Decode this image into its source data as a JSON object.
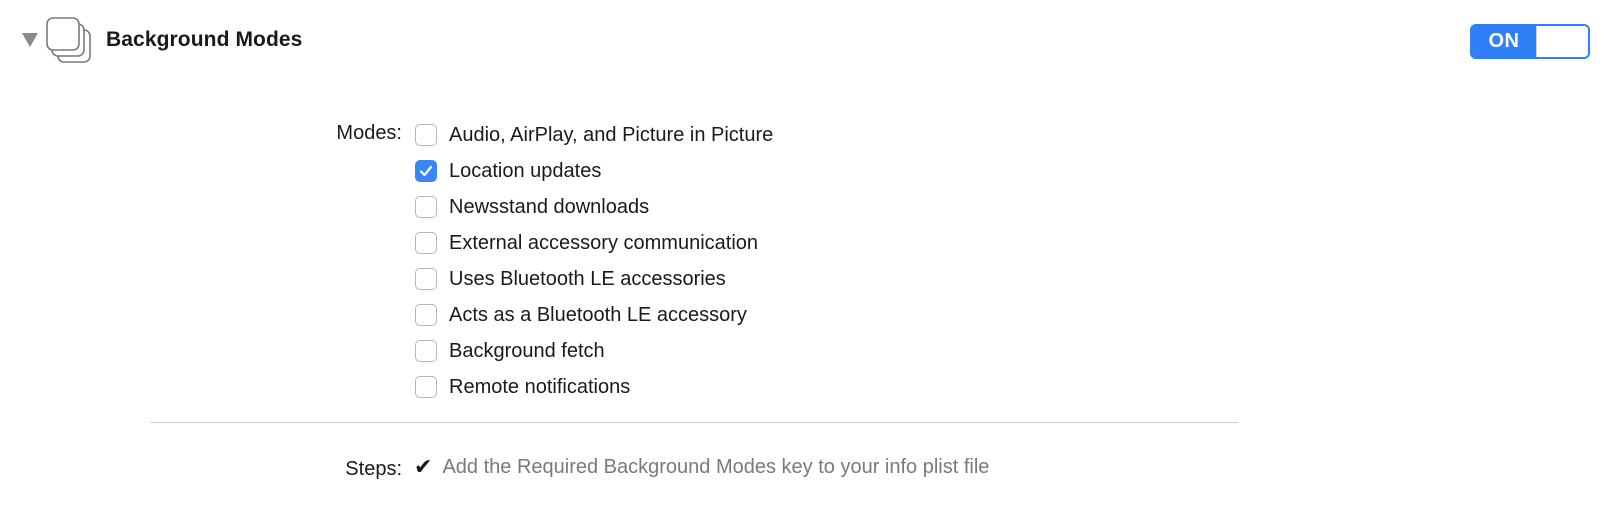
{
  "header": {
    "title": "Background Modes",
    "disclosure_icon": "triangle-down-icon",
    "capability_icon": "stacked-squares-icon"
  },
  "toggle": {
    "label": "ON",
    "state": true,
    "accent_color": "#2f7ff7"
  },
  "modes": {
    "label": "Modes:",
    "items": [
      {
        "label": "Audio, AirPlay, and Picture in Picture",
        "checked": false
      },
      {
        "label": "Location updates",
        "checked": true
      },
      {
        "label": "Newsstand downloads",
        "checked": false
      },
      {
        "label": "External accessory communication",
        "checked": false
      },
      {
        "label": "Uses Bluetooth LE accessories",
        "checked": false
      },
      {
        "label": "Acts as a Bluetooth LE accessory",
        "checked": false
      },
      {
        "label": "Background fetch",
        "checked": false
      },
      {
        "label": "Remote notifications",
        "checked": false
      }
    ]
  },
  "steps": {
    "label": "Steps:",
    "items": [
      {
        "check": "✔",
        "text": "Add the Required Background Modes key to your info plist file"
      }
    ]
  }
}
